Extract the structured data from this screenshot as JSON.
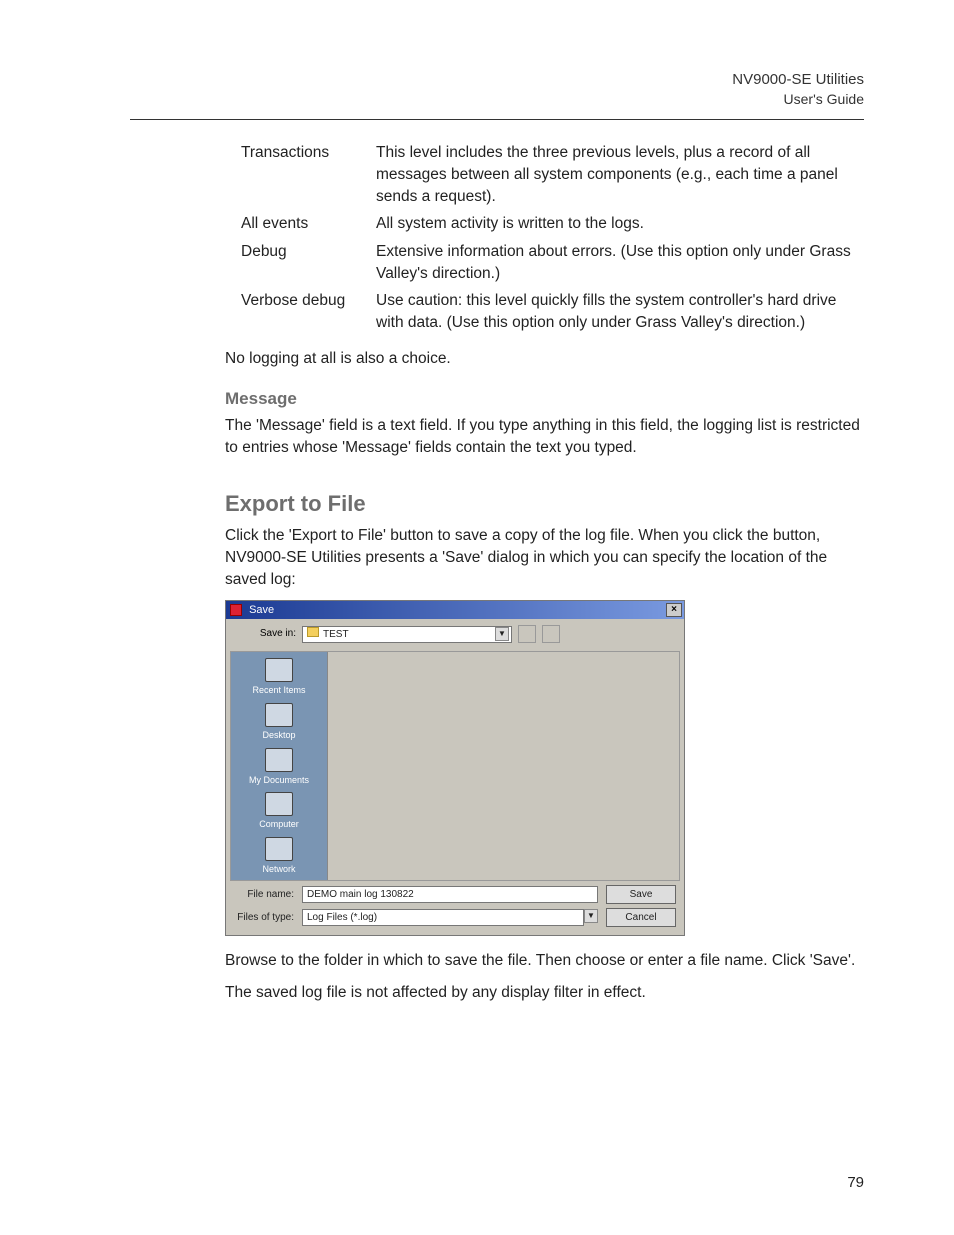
{
  "header": {
    "title": "NV9000-SE Utilities",
    "subtitle": "User's Guide"
  },
  "levels": [
    {
      "name": "Transactions",
      "desc": "This level includes the three previous levels, plus a record of all messages between all system components (e.g., each time a panel sends a request)."
    },
    {
      "name": "All events",
      "desc": "All system activity is written to the logs."
    },
    {
      "name": "Debug",
      "desc": "Extensive information about errors. (Use this option only under Grass Valley's direction.)"
    },
    {
      "name": "Verbose debug",
      "desc": "Use caution: this level quickly fills the system controller's hard drive with data. (Use this option only under Grass Valley's direction.)"
    }
  ],
  "no_logging": "No logging at all is also a choice.",
  "message_h": "Message",
  "message_p": "The 'Message' field is a text field. If you type anything in this field, the logging list is restricted to entries whose 'Message' fields contain the text you typed.",
  "export_h": "Export to File",
  "export_p1": "Click the 'Export to File' button to save a copy of the log file. When you click the button, NV9000-SE Utilities presents a 'Save' dialog in which you can specify the location of the saved log:",
  "export_p2": "Browse to the folder in which to save the file. Then choose or enter a file name. Click 'Save'.",
  "export_p3": "The saved log file is not affected by any display filter in effect.",
  "dialog": {
    "title": "Save",
    "save_in_label": "Save in:",
    "save_in_value": "TEST",
    "places": [
      "Recent Items",
      "Desktop",
      "My Documents",
      "Computer",
      "Network"
    ],
    "file_name_label": "File name:",
    "file_name_value": "DEMO main log 130822",
    "file_type_label": "Files of type:",
    "file_type_value": "Log Files (*.log)",
    "save_btn": "Save",
    "cancel_btn": "Cancel"
  },
  "page_number": "79"
}
